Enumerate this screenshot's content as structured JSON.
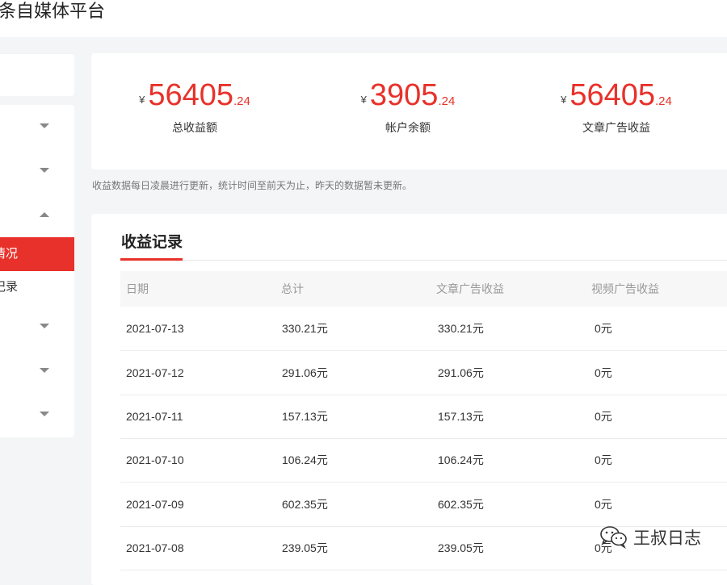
{
  "app": {
    "title": "条自媒体平台"
  },
  "sidebar": {
    "active_item": "情况",
    "sub_item": "记录"
  },
  "stats": [
    {
      "currency": "¥",
      "integer": "56405",
      "decimal": ".24",
      "label": "总收益额"
    },
    {
      "currency": "¥",
      "integer": "3905",
      "decimal": ".24",
      "label": "帐户余额"
    },
    {
      "currency": "¥",
      "integer": "56405",
      "decimal": ".24",
      "label": "文章广告收益"
    }
  ],
  "note": "收益数据每日凌晨进行更新，统计时间至前天为止，昨天的数据暂未更新。",
  "records": {
    "title": "收益记录",
    "columns": [
      "日期",
      "总计",
      "文章广告收益",
      "视频广告收益"
    ],
    "rows": [
      [
        "2021-07-13",
        "330.21元",
        "330.21元",
        "0元"
      ],
      [
        "2021-07-12",
        "291.06元",
        "291.06元",
        "0元"
      ],
      [
        "2021-07-11",
        "157.13元",
        "157.13元",
        "0元"
      ],
      [
        "2021-07-10",
        "106.24元",
        "106.24元",
        "0元"
      ],
      [
        "2021-07-09",
        "602.35元",
        "602.35元",
        "0元"
      ],
      [
        "2021-07-08",
        "239.05元",
        "239.05元",
        "0元"
      ]
    ]
  },
  "watermark": {
    "text": "王叔日志",
    "icon": "wechat-icon"
  },
  "colors": {
    "accent": "#e8312a"
  }
}
